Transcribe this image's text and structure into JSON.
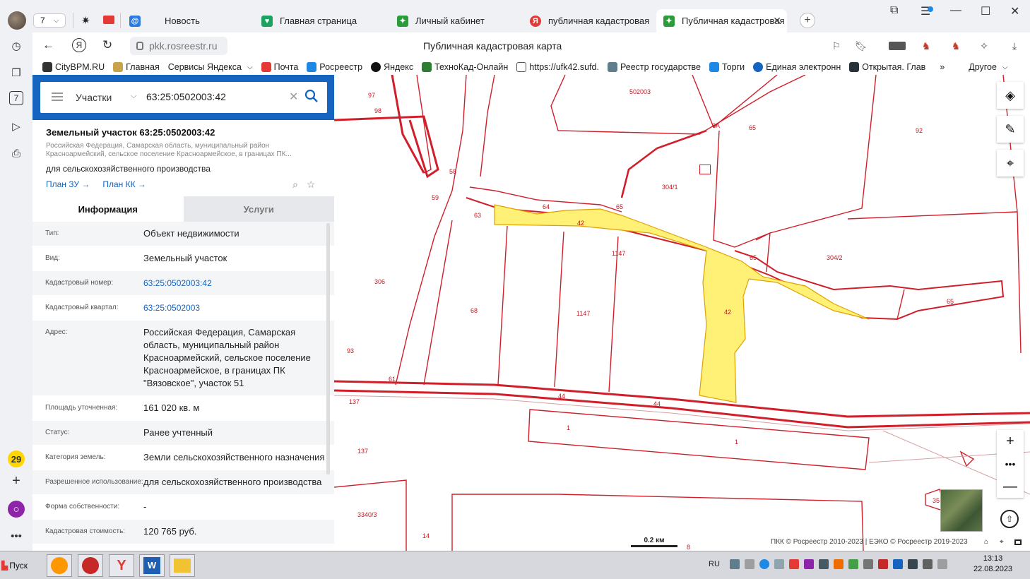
{
  "browser": {
    "tab_count": "7",
    "tabs": [
      {
        "label": "Новость",
        "icon": "yandex-mail-icon",
        "color": "#2a7ae2"
      },
      {
        "label": "Главная страница",
        "icon": "gosuslugi-icon",
        "color": "#1aa260"
      },
      {
        "label": "Личный кабинет",
        "icon": "rosreestr-icon",
        "color": "#2a9d3a"
      },
      {
        "label": "публичная кадастровая к",
        "icon": "yandex-icon",
        "color": "#e53935"
      },
      {
        "label": "Публичная кадастровая",
        "icon": "rosreestr-icon",
        "color": "#2a9d3a",
        "active": true
      }
    ],
    "url": "pkk.rosreestr.ru",
    "page_title": "Публичная кадастровая карта",
    "bookmarks": [
      "CityBPM.RU",
      "Главная",
      "Сервисы Яндекса",
      "Почта",
      "Росреестр",
      "Яндекс",
      "ТехноКад-Онлайн",
      "https://ufk42.sufd.",
      "Реестр государстве",
      "Торги",
      "Единая электронн",
      "Открытая. Глав"
    ],
    "bookmarks_other": "Другое",
    "sidebar_badge": "29",
    "sidebar_seven": "7"
  },
  "search": {
    "mode": "Участки",
    "value": "63:25:0502003:42"
  },
  "object": {
    "title": "Земельный участок 63:25:0502003:42",
    "address_short": "Российская Федерация, Самарская область, муниципальный район Красноармейский, сельское поселение Красноармейское, в границах ПК...",
    "purpose": "для сельскохозяйственного производства",
    "link1": "План ЗУ",
    "link2": "План КК"
  },
  "info_tabs": {
    "info": "Информация",
    "services": "Услуги"
  },
  "properties": [
    {
      "k": "Тип:",
      "v": "Объект недвижимости"
    },
    {
      "k": "Вид:",
      "v": "Земельный участок"
    },
    {
      "k": "Кадастровый номер:",
      "v": "63:25:0502003:42",
      "link": true
    },
    {
      "k": "Кадастровый квартал:",
      "v": "63:25:0502003",
      "link": true
    },
    {
      "k": "Адрес:",
      "v": "Российская Федерация, Самарская область, муниципальный район Красноармейский, сельское поселение Красноармейское, в границах ПК \"Вязовское\", участок 51"
    },
    {
      "k": "Площадь уточненная:",
      "v": "161 020 кв. м"
    },
    {
      "k": "Статус:",
      "v": "Ранее учтенный"
    },
    {
      "k": "Категория земель:",
      "v": "Земли сельскохозяйственного назначения"
    },
    {
      "k": "Разрешенное использование:",
      "v": "для сельскохозяйственного производства"
    },
    {
      "k": "Форма собственности:",
      "v": "-"
    },
    {
      "k": "Кадастровая стоимость:",
      "v": "120 765 руб."
    }
  ],
  "map": {
    "labels": [
      "502003",
      "97",
      "98",
      "6A",
      "65",
      "92",
      "58",
      "59",
      "63",
      "64",
      "65",
      "304/1",
      "42",
      "1147",
      "65",
      "304/2",
      "306",
      "68",
      "1147",
      "42",
      "65",
      "93",
      "61",
      "44",
      "44",
      "137",
      "1",
      "1",
      "137",
      "35",
      "3340/3",
      "14",
      "8"
    ],
    "scale": "0.2 км",
    "copyright": "ПКК © Росреестр 2010-2023 | ЕЭКО © Росреестр 2019-2023",
    "colors": {
      "boundary": "#d01f2a",
      "selected": "#fff176"
    }
  },
  "taskbar": {
    "start": "Пуск",
    "lang": "RU",
    "time": "13:13",
    "date": "22.08.2023"
  }
}
